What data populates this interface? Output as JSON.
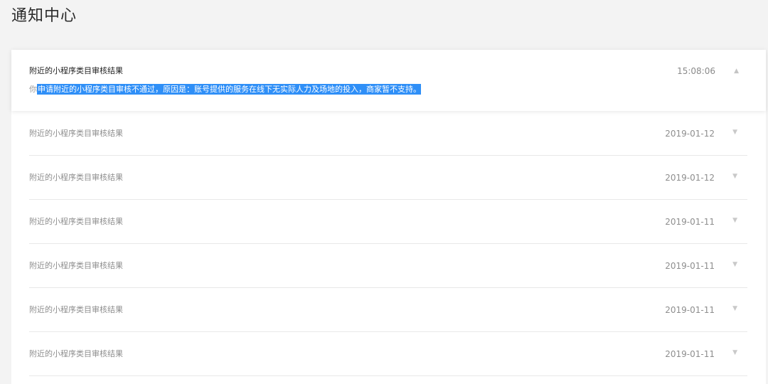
{
  "page": {
    "title": "通知中心"
  },
  "expanded_item": {
    "title": "附近的小程序类目审核结果",
    "time": "15:08:06",
    "content_prefix": "你",
    "content_selected": "申请附近的小程序类目审核不通过，原因是：账号提供的服务在线下无实际人力及场地的投入，商家暂不支持。",
    "arrow_icon": "chevron-up"
  },
  "items": [
    {
      "title": "附近的小程序类目审核结果",
      "time": "2019-01-12",
      "arrow_icon": "chevron-down"
    },
    {
      "title": "附近的小程序类目审核结果",
      "time": "2019-01-12",
      "arrow_icon": "chevron-down"
    },
    {
      "title": "附近的小程序类目审核结果",
      "time": "2019-01-11",
      "arrow_icon": "chevron-down"
    },
    {
      "title": "附近的小程序类目审核结果",
      "time": "2019-01-11",
      "arrow_icon": "chevron-down"
    },
    {
      "title": "附近的小程序类目审核结果",
      "time": "2019-01-11",
      "arrow_icon": "chevron-down"
    },
    {
      "title": "附近的小程序类目审核结果",
      "time": "2019-01-11",
      "arrow_icon": "chevron-down"
    }
  ],
  "colors": {
    "selection": "#2f8ff7",
    "background": "#f3f3f3"
  }
}
